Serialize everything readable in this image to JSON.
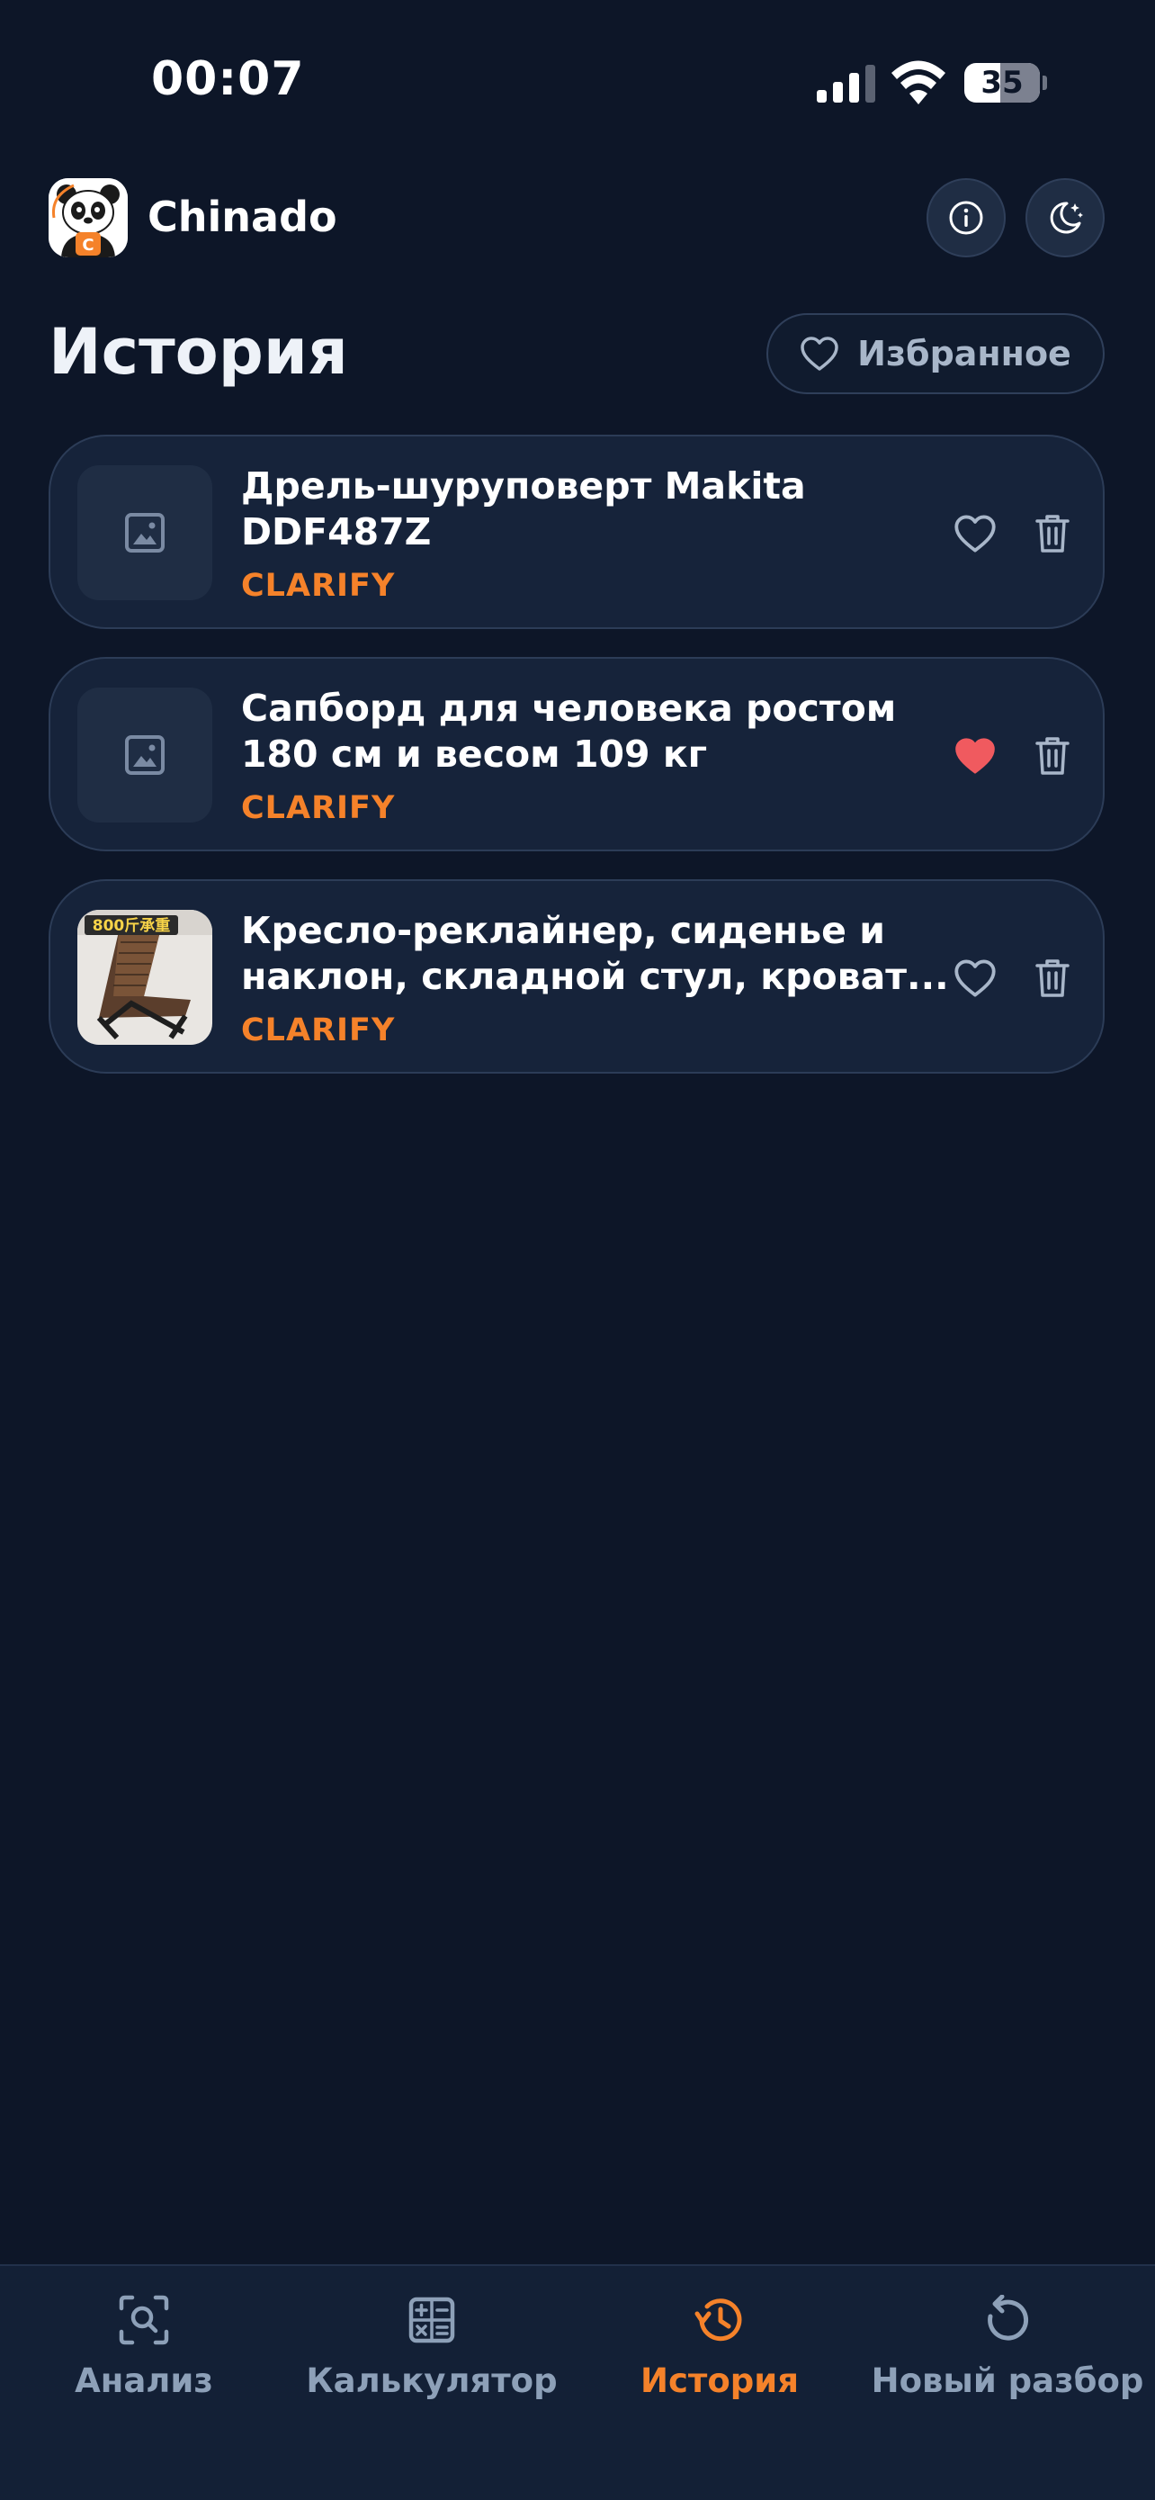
{
  "status_bar": {
    "time": "00:07",
    "battery": "35"
  },
  "header": {
    "app_name": "Chinado",
    "logo_letter": "C",
    "info_icon": "info-icon",
    "theme_icon": "moon-stars-icon"
  },
  "page": {
    "title": "История",
    "favorites_label": "Избранное"
  },
  "history": [
    {
      "title": "Дрель-шуруповерт Makita DDF487Z",
      "tag": "CLARIFY",
      "favorite": false,
      "thumbnail": "image-placeholder"
    },
    {
      "title": "Сапборд для человека ростом 180 см и весом 109 кг",
      "tag": "CLARIFY",
      "favorite": true,
      "thumbnail": "image-placeholder"
    },
    {
      "title": "Кресло-реклайнер, сиденье и наклон, складной стул, кроват...",
      "tag": "CLARIFY",
      "favorite": false,
      "thumbnail": "product-photo",
      "thumbnail_caption": "800斤承重"
    }
  ],
  "nav": [
    {
      "label": "Анализ",
      "icon": "scan-search-icon",
      "active": false
    },
    {
      "label": "Калькулятор",
      "icon": "calculator-icon",
      "active": false
    },
    {
      "label": "История",
      "icon": "history-icon",
      "active": true
    },
    {
      "label": "Новый разбор",
      "icon": "refresh-icon",
      "active": false
    }
  ],
  "colors": {
    "background": "#0d1628",
    "card": "#16233a",
    "accent": "#f5822a",
    "favorite": "#f05a5f",
    "muted": "#8da0b8"
  }
}
